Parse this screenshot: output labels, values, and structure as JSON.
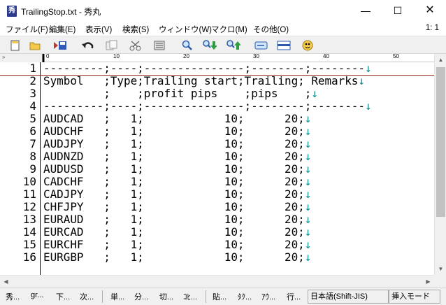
{
  "window": {
    "title": "TrailingStop.txt - 秀丸",
    "app_icon_glyph": "秀",
    "minimize_glyph": "—",
    "maximize_glyph": "☐",
    "close_glyph": "✕"
  },
  "menu": {
    "items": [
      "ファイル(F)",
      "編集(E)",
      "表示(V)",
      "検索(S)",
      "ウィンドウ(W)",
      "マクロ(M)",
      "その他(O)"
    ],
    "position": "1: 1"
  },
  "toolbar": {
    "icons": [
      "new-file-icon",
      "open-file-icon",
      "save-file-icon",
      "undo-icon",
      "copy-icon",
      "cut-icon",
      "paste-icon",
      "search-icon",
      "search-down-icon",
      "search-up-icon",
      "replace-icon",
      "window-icon",
      "help-icon"
    ]
  },
  "ruler": {
    "margin_glyph": "»",
    "marks": [
      "0",
      "10",
      "20",
      "30",
      "40",
      "50"
    ]
  },
  "editor": {
    "eol_mark": "↓",
    "lines": [
      {
        "num": "1",
        "text": "---------;----;---------------;--------;--------"
      },
      {
        "num": "2",
        "text": "Symbol   ;Type;Trailing start;Trailing; Remarks"
      },
      {
        "num": "3",
        "text": "         ;    ;profit pips    ;pips    ;"
      },
      {
        "num": "4",
        "text": "---------;----;---------------;--------;--------"
      },
      {
        "num": "5",
        "text": "AUDCAD   ;   1;            10;      20;"
      },
      {
        "num": "6",
        "text": "AUDCHF   ;   1;            10;      20;"
      },
      {
        "num": "7",
        "text": "AUDJPY   ;   1;            10;      20;"
      },
      {
        "num": "8",
        "text": "AUDNZD   ;   1;            10;      20;"
      },
      {
        "num": "9",
        "text": "AUDUSD   ;   1;            10;      20;"
      },
      {
        "num": "10",
        "text": "CADCHF   ;   1;            10;      20;"
      },
      {
        "num": "11",
        "text": "CADJPY   ;   1;            10;      20;"
      },
      {
        "num": "12",
        "text": "CHFJPY   ;   1;            10;      20;"
      },
      {
        "num": "13",
        "text": "EURAUD   ;   1;            10;      20;"
      },
      {
        "num": "14",
        "text": "EURCAD   ;   1;            10;      20;"
      },
      {
        "num": "15",
        "text": "EURCHF   ;   1;            10;      20;"
      },
      {
        "num": "16",
        "text": "EURGBP   ;   1;            10;      20;"
      }
    ]
  },
  "scrollbar": {
    "up_glyph": "▲",
    "down_glyph": "▼",
    "left_glyph": "◀",
    "right_glyph": "▶"
  },
  "statusbar": {
    "function_keys": [
      "秀...",
      "gr...",
      "下...",
      "次...",
      "単...",
      "分...",
      "切...",
      "ｺﾋ...",
      "貼...",
      "ﾀｸ...",
      "ｱｳ...",
      "行..."
    ],
    "encoding": "日本語(Shift-JIS)",
    "mode": "挿入モード"
  }
}
